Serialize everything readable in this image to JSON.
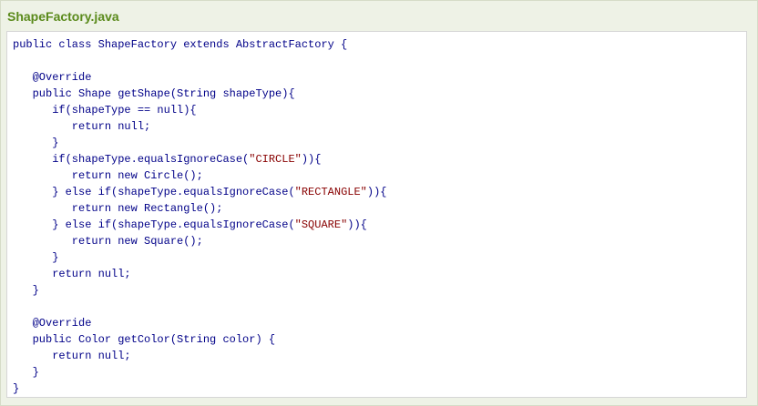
{
  "file_title": "ShapeFactory.java",
  "code": {
    "language": "java",
    "lines": [
      [
        {
          "t": "public class ShapeFactory extends AbstractFactory {"
        }
      ],
      [
        {
          "t": ""
        }
      ],
      [
        {
          "t": "   @Override"
        }
      ],
      [
        {
          "t": "   public Shape getShape(String shapeType){"
        }
      ],
      [
        {
          "t": "      if(shapeType == null){"
        }
      ],
      [
        {
          "t": "         return null;"
        }
      ],
      [
        {
          "t": "      }"
        }
      ],
      [
        {
          "t": "      if(shapeType.equalsIgnoreCase("
        },
        {
          "t": "\"CIRCLE\"",
          "k": "str"
        },
        {
          "t": ")){"
        }
      ],
      [
        {
          "t": "         return new Circle();"
        }
      ],
      [
        {
          "t": "      } else if(shapeType.equalsIgnoreCase("
        },
        {
          "t": "\"RECTANGLE\"",
          "k": "str"
        },
        {
          "t": ")){"
        }
      ],
      [
        {
          "t": "         return new Rectangle();"
        }
      ],
      [
        {
          "t": "      } else if(shapeType.equalsIgnoreCase("
        },
        {
          "t": "\"SQUARE\"",
          "k": "str"
        },
        {
          "t": ")){"
        }
      ],
      [
        {
          "t": "         return new Square();"
        }
      ],
      [
        {
          "t": "      }"
        }
      ],
      [
        {
          "t": "      return null;"
        }
      ],
      [
        {
          "t": "   }"
        }
      ],
      [
        {
          "t": ""
        }
      ],
      [
        {
          "t": "   @Override"
        }
      ],
      [
        {
          "t": "   public Color getColor(String color) {"
        }
      ],
      [
        {
          "t": "      return null;"
        }
      ],
      [
        {
          "t": "   }"
        }
      ],
      [
        {
          "t": "}"
        }
      ]
    ]
  },
  "colors": {
    "title": "#5a8a1b",
    "code_text": "#000088",
    "string_literal": "#880000",
    "panel_background": "#eef2e6",
    "code_background": "#ffffff"
  }
}
